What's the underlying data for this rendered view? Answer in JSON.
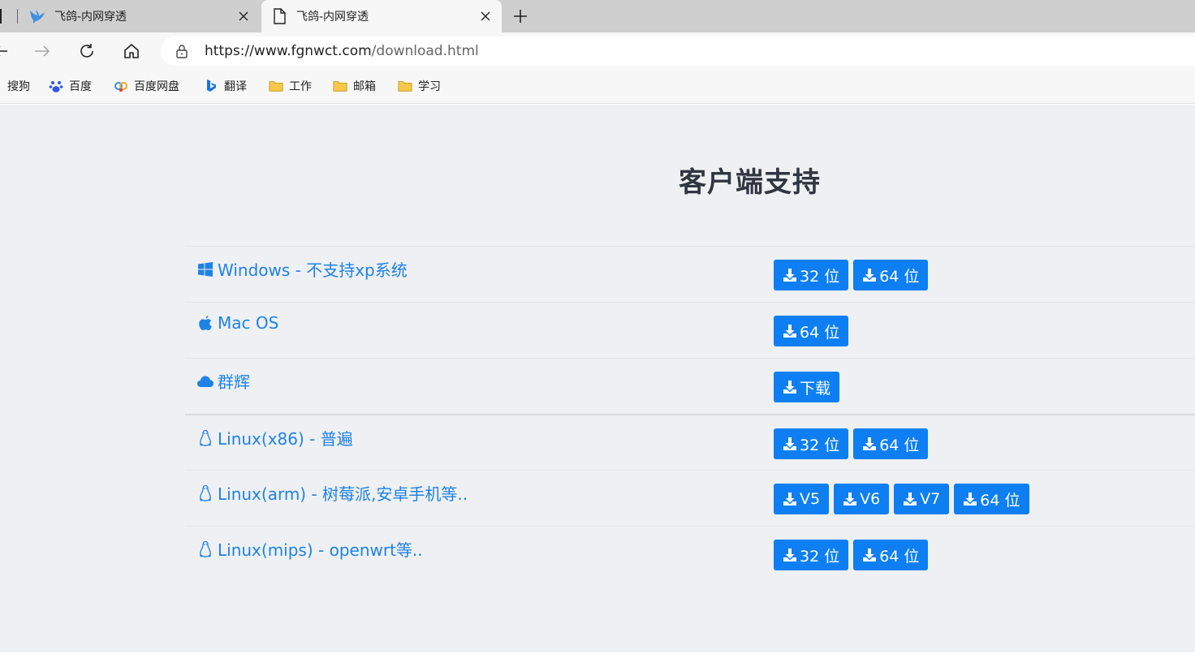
{
  "browser": {
    "tabs": [
      {
        "title": "飞鸽-内网穿透",
        "active": false
      },
      {
        "title": "飞鸽-内网穿透",
        "active": true
      }
    ],
    "address": {
      "host": "https://www.fgnwct.com",
      "path": "/download.html"
    },
    "bookmarks": [
      {
        "label": "搜狗",
        "icon": "none"
      },
      {
        "label": "百度",
        "icon": "baidu-paw-icon"
      },
      {
        "label": "百度网盘",
        "icon": "baidu-netdisk-icon"
      },
      {
        "label": "翻译",
        "icon": "bing-translate-icon"
      },
      {
        "label": "工作",
        "icon": "folder-icon"
      },
      {
        "label": "邮箱",
        "icon": "folder-icon"
      },
      {
        "label": "学习",
        "icon": "folder-icon"
      }
    ]
  },
  "page": {
    "heading": "客户端支持",
    "rows": [
      {
        "label": "Windows - 不支持xp系统",
        "icon": "windows-icon",
        "buttons": [
          "32 位",
          "64 位"
        ]
      },
      {
        "label": "Mac OS",
        "icon": "apple-icon",
        "buttons": [
          "64 位"
        ]
      },
      {
        "label": "群辉",
        "icon": "cloud-icon",
        "buttons": [
          "下载"
        ]
      },
      {
        "label": "Linux(x86) - 普遍",
        "icon": "linux-icon",
        "buttons": [
          "32 位",
          "64 位"
        ]
      },
      {
        "label": "Linux(arm) - 树莓派,安卓手机等..",
        "icon": "linux-icon",
        "buttons": [
          "V5",
          "V6",
          "V7",
          "64 位"
        ]
      },
      {
        "label": "Linux(mips) - openwrt等..",
        "icon": "linux-icon",
        "buttons": [
          "32 位",
          "64 位"
        ]
      }
    ]
  },
  "colors": {
    "accent": "#0d7ff2",
    "link": "#1e82e6",
    "heading": "#303641",
    "page_bg": "#eef0f3"
  }
}
